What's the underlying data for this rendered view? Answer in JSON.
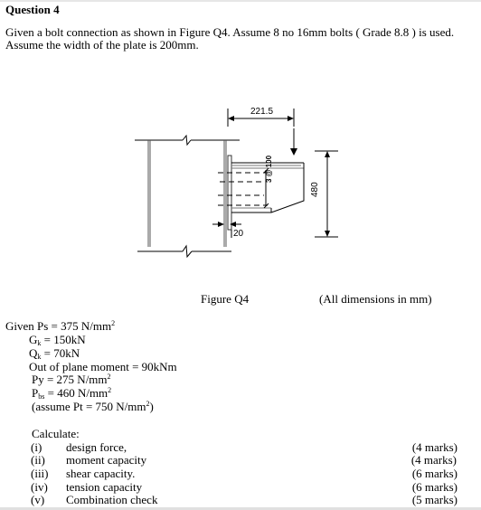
{
  "question": {
    "title": "Question 4",
    "intro_line1": "Given a bolt connection as shown in Figure Q4. Assume 8 no 16mm bolts ( Grade 8.8 ) is used.",
    "intro_line2": "Assume the width of the plate is 200mm."
  },
  "figure": {
    "caption": "Figure Q4",
    "units_note": "(All dimensions in mm)",
    "dimensions": {
      "horizontal_span": "221.5",
      "bolt_spacing": "3 @ 100",
      "height": "480",
      "plate_offset": "20"
    }
  },
  "given": {
    "ps_label": "Given Ps = 375 N/mm",
    "ps_sup": "2",
    "gk_label": "G",
    "gk_sub": "k",
    "gk_value": " = 150kN",
    "qk_label": "Q",
    "qk_sub": "k",
    "qk_value": " = 70kN",
    "moment": "Out of plane moment = 90kNm",
    "py_label": "Py = 275 N/mm",
    "py_sup": "2",
    "pbs_label": "P",
    "pbs_sub": "bs",
    "pbs_value": " = 460 N/mm",
    "pbs_sup": "2",
    "pt_prefix": "(assume Pt = 750 N/mm",
    "pt_sup": "2",
    "pt_suffix": ")"
  },
  "calculate": {
    "heading": "Calculate:",
    "items": [
      {
        "num": "(i)",
        "text": "design force,",
        "marks": "(4 marks)"
      },
      {
        "num": "(ii)",
        "text": "moment capacity",
        "marks": "(4 marks)"
      },
      {
        "num": "(iii)",
        "text": "shear capacity.",
        "marks": "(6 marks)"
      },
      {
        "num": "(iv)",
        "text": "tension capacity",
        "marks": "(6 marks)"
      },
      {
        "num": "(v)",
        "text": "Combination check",
        "marks": "(5 marks)"
      }
    ]
  }
}
